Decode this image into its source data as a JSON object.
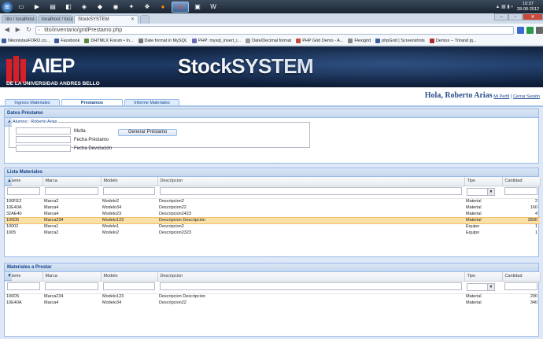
{
  "taskbar": {
    "time": "10:37",
    "date": "28-08-2012"
  },
  "browser": {
    "tabs": [
      {
        "label": "tito / localhost / inventari"
      },
      {
        "label": "localhost / localhost / inventario"
      },
      {
        "label": "StockSYSTEM"
      }
    ],
    "url": "tito/inventario/gridPrestamo.php",
    "bookmarks": [
      {
        "label": "NikonistasFORO.co...",
        "color": "#3a5fa0"
      },
      {
        "label": "Facebook",
        "color": "#3b5998"
      },
      {
        "label": "DHTMLX Forum • In...",
        "color": "#5a8a3a"
      },
      {
        "label": "Date format in MySQL",
        "color": "#777777"
      },
      {
        "label": "PHP: mysql_insert_i...",
        "color": "#6a6ab0"
      },
      {
        "label": "Date/Decimal format",
        "color": "#999999"
      },
      {
        "label": "PHP Grid Demo - A...",
        "color": "#c84a3a"
      },
      {
        "label": "Flexigrid",
        "color": "#888888"
      },
      {
        "label": "phpGrid | Screenshots",
        "color": "#3a5fa0"
      },
      {
        "label": "Demos -- Trirand jq...",
        "color": "#b02a2a"
      }
    ]
  },
  "header": {
    "logo_text": "AIEP",
    "logo_sub": "DE LA UNIVERSIDAD ANDRES BELLO",
    "brand": "StockSYSTEM"
  },
  "user": {
    "greeting": "Hola, Roberto Arias",
    "profile_link": "Mi Perfil",
    "separator": "|",
    "logout_link": "Cerrar Sesión"
  },
  "nav_tabs": [
    {
      "label": "Ingreso Materiales"
    },
    {
      "label": "Prestamos"
    },
    {
      "label": "Informe Materiales"
    }
  ],
  "datos": {
    "title": "Datos Préstamo",
    "legend": "Alumno : Roberto Arias",
    "fields": [
      {
        "label": "Multa"
      },
      {
        "label": "Fecha Préstamo"
      },
      {
        "label": "Fecha Devolución"
      }
    ],
    "button": "Generar Préstamo"
  },
  "lista": {
    "title": "Lista Materiales",
    "columns": [
      "IdSerie",
      "Marca",
      "Modelo",
      "Descripcion",
      "Tipo",
      "Cantidad"
    ],
    "rows": [
      [
        "100FE2",
        "Marca2",
        "Modelo2",
        "Descripcion2",
        "Material",
        "2"
      ],
      [
        "10E40A",
        "Marca4",
        "Modelo34",
        "Descripcion22",
        "Material",
        "160"
      ],
      [
        "32AE40",
        "Marca4",
        "Modelo23",
        "Descripcion2423",
        "Material",
        "4"
      ],
      [
        "100D5",
        "Marca234",
        "Modelo123",
        "Descripcion Descripcion",
        "Material",
        "2800"
      ],
      [
        "10002",
        "Marca1",
        "Modelo1",
        "Descripcion2",
        "Equipo",
        "1"
      ],
      [
        "1005",
        "Marca2",
        "Modelo2",
        "Descripcion2323",
        "Equipo",
        "1"
      ]
    ]
  },
  "prestar": {
    "title": "Materiales a Prestar",
    "columns": [
      "IdSerie",
      "Marca",
      "Modelo",
      "Descripcion",
      "Tipo",
      "Cantidad"
    ],
    "rows": [
      [
        "100D5",
        "Marca234",
        "Modelo123",
        "Descripcion Descripcion",
        "Material",
        "200"
      ],
      [
        "10E40A",
        "Marca4",
        "Modelo34",
        "Descripcion22",
        "Material",
        "340"
      ]
    ]
  }
}
